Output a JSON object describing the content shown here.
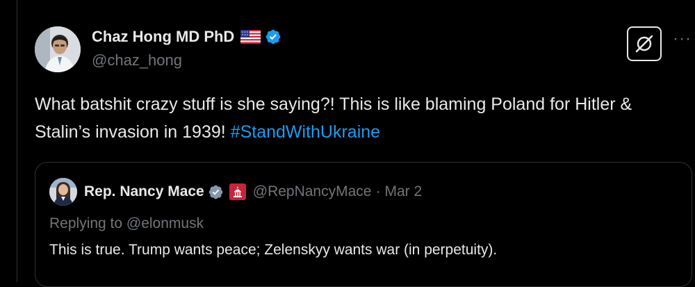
{
  "colors": {
    "background": "#000000",
    "text_primary": "#e7e9ea",
    "text_secondary": "#71767b",
    "link": "#1d9bf0",
    "border": "#2f3336",
    "verified_blue": "#1d9bf0",
    "verified_gray": "#829aab"
  },
  "tweet": {
    "author": {
      "display_name": "Chaz Hong MD PhD",
      "handle": "@chaz_hong",
      "flag_icon": "us-flag-icon",
      "verified_icon": "verified-badge-icon"
    },
    "text_before_hashtag": "What batshit crazy stuff is she saying?! This is like blaming Poland for Hitler & Stalin’s invasion in 1939!",
    "hashtag": "#StandWithUkraine",
    "actions": {
      "grok_icon": "grok-icon",
      "more_label": "···"
    }
  },
  "quote": {
    "author": {
      "display_name": "Rep. Nancy Mace",
      "handle": "@RepNancyMace",
      "verified_icon": "gray-verified-badge-icon",
      "affiliation_icon": "us-capitol-icon"
    },
    "separator": "·",
    "date": "Mar 2",
    "replying_to": "Replying to @elonmusk",
    "text": "This is true. Trump wants peace; Zelenskyy wants war (in perpetuity)."
  }
}
